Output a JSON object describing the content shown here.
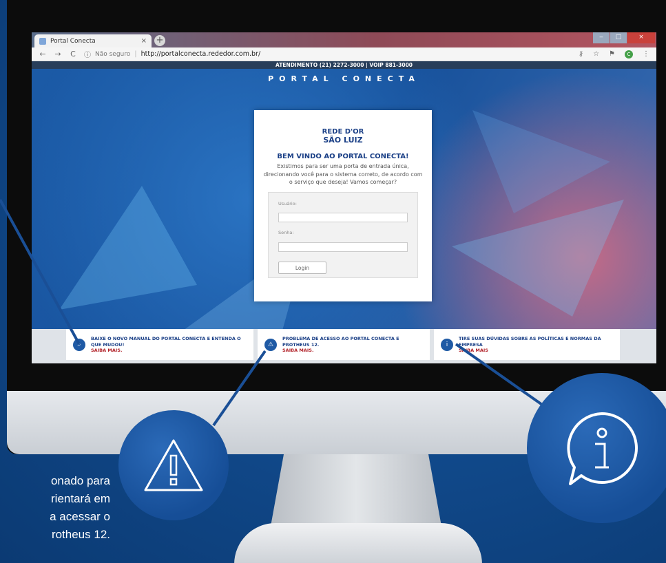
{
  "browser": {
    "tab_title": "Portal Conecta",
    "tab_close": "×",
    "new_tab": "+",
    "back": "←",
    "forward": "→",
    "reload": "C",
    "security_label": "Não seguro",
    "url": "http://portalconecta.rededor.com.br/"
  },
  "page": {
    "top_strip": "ATENDIMENTO (21) 2272-3000 | VOIP 881-3000",
    "portal_title": "PORTAL CONECTA",
    "logo_top": "REDE D'OR",
    "logo_bottom": "SÃO LUIZ",
    "welcome": "BEM VINDO AO PORTAL CONECTA!",
    "intro": "Existimos para ser uma porta de entrada única, direcionando você para o sistema correto, de acordo com o serviço que deseja! Vamos começar?",
    "login": {
      "user_label": "Usuário:",
      "user_value": "",
      "password_label": "Senha:",
      "password_value": "",
      "button": "Login"
    },
    "info_items": [
      {
        "icon": "search-icon",
        "text": "BAIXE O NOVO MANUAL DO PORTAL CONECTA E ENTENDA O QUE MUDOU!",
        "more": "SAIBA MAIS."
      },
      {
        "icon": "warning-icon",
        "text": "PROBLEMA DE ACESSO AO PORTAL CONECTA E PROTHEUS 12.",
        "more": "SAIBA MAIS."
      },
      {
        "icon": "info-icon",
        "text": "TIRE SUAS DÚVIDAS SOBRE AS POLÍTICAS E NORMAS DA EMPRESA",
        "more": "SAIBA MAIS"
      }
    ]
  },
  "slide_text": {
    "line1": "onado para",
    "line2": "rientará em",
    "line3": "a acessar o",
    "line4": "rotheus 12."
  },
  "colors": {
    "brand_blue": "#1a3f86",
    "accent_red": "#b2232a",
    "background": "#114a8c"
  }
}
